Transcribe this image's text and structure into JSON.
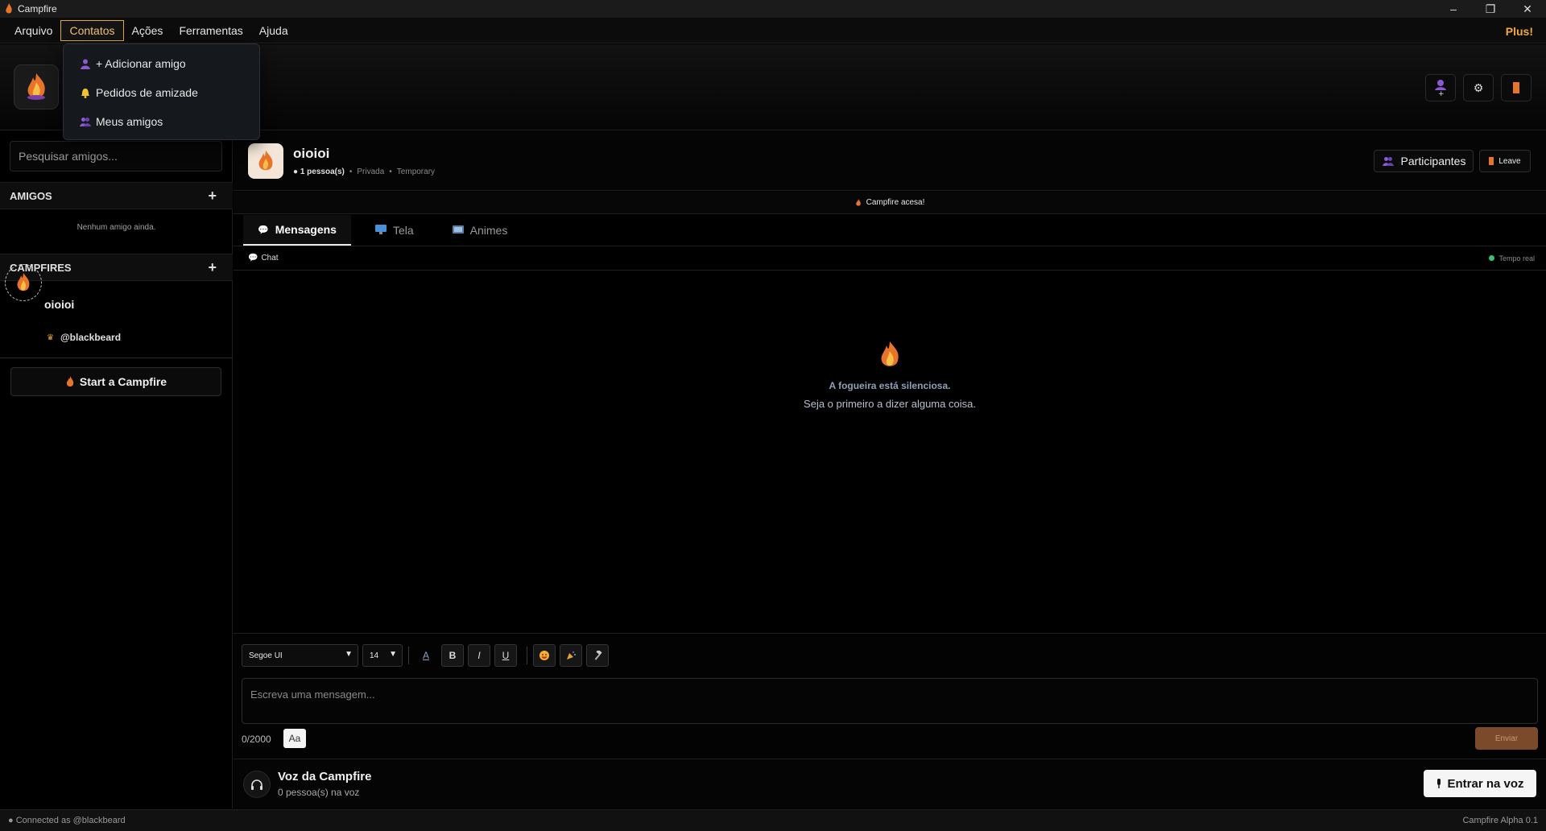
{
  "window": {
    "title": "Campfire",
    "plus_label": "Plus!"
  },
  "menu": {
    "items": [
      "Arquivo",
      "Contatos",
      "Ações",
      "Ferramentas",
      "Ajuda"
    ],
    "open_index": 1,
    "dropdown": [
      {
        "label": "+ Adicionar amigo",
        "icon": "user-icon"
      },
      {
        "label": "Pedidos de amizade",
        "icon": "bell-icon"
      },
      {
        "label": "Meus amigos",
        "icon": "users-icon"
      }
    ]
  },
  "sidebar": {
    "search_placeholder": "Pesquisar amigos...",
    "friends_header": "AMIGOS",
    "friends_empty": "Nenhum amigo ainda.",
    "campfires_header": "CAMPFIRES",
    "campfires": [
      {
        "name": "oioioi",
        "owner": "@blackbeard"
      }
    ],
    "start_label": "Start a Campfire"
  },
  "room": {
    "name": "oioioi",
    "count": "1 pessoa(s)",
    "privacy": "Privada",
    "duration": "Temporary",
    "participants_label": "Participantes",
    "leave_label": "Leave",
    "status_banner": "Campfire acesa!",
    "tabs": [
      {
        "label": "Mensagens",
        "icon": "speech-bubble-icon",
        "active": true
      },
      {
        "label": "Tela",
        "icon": "monitor-icon",
        "active": false
      },
      {
        "label": "Animes",
        "icon": "tv-icon",
        "active": false
      }
    ],
    "chat_label": "Chat",
    "realtime_label": "Tempo real",
    "empty_title": "A fogueira está silenciosa.",
    "empty_sub": "Seja o primeiro a dizer alguma coisa."
  },
  "composer": {
    "font": "Segoe UI",
    "size": "14",
    "bold": "B",
    "italic": "I",
    "underline": "U",
    "placeholder": "Escreva uma mensagem...",
    "counter": "0/2000",
    "aa": "Aa",
    "send": "Enviar"
  },
  "voice": {
    "title": "Voz da Campfire",
    "sub": "0 pessoa(s) na voz",
    "join": "Entrar na voz"
  },
  "status": {
    "connected": "● Connected as @blackbeard",
    "version": "Campfire Alpha 0.1"
  },
  "colors": {
    "accent": "#f2a93b",
    "flame": "#e8742a",
    "send_bg": "#7a4a2a",
    "realtime_dot": "#38c172"
  }
}
